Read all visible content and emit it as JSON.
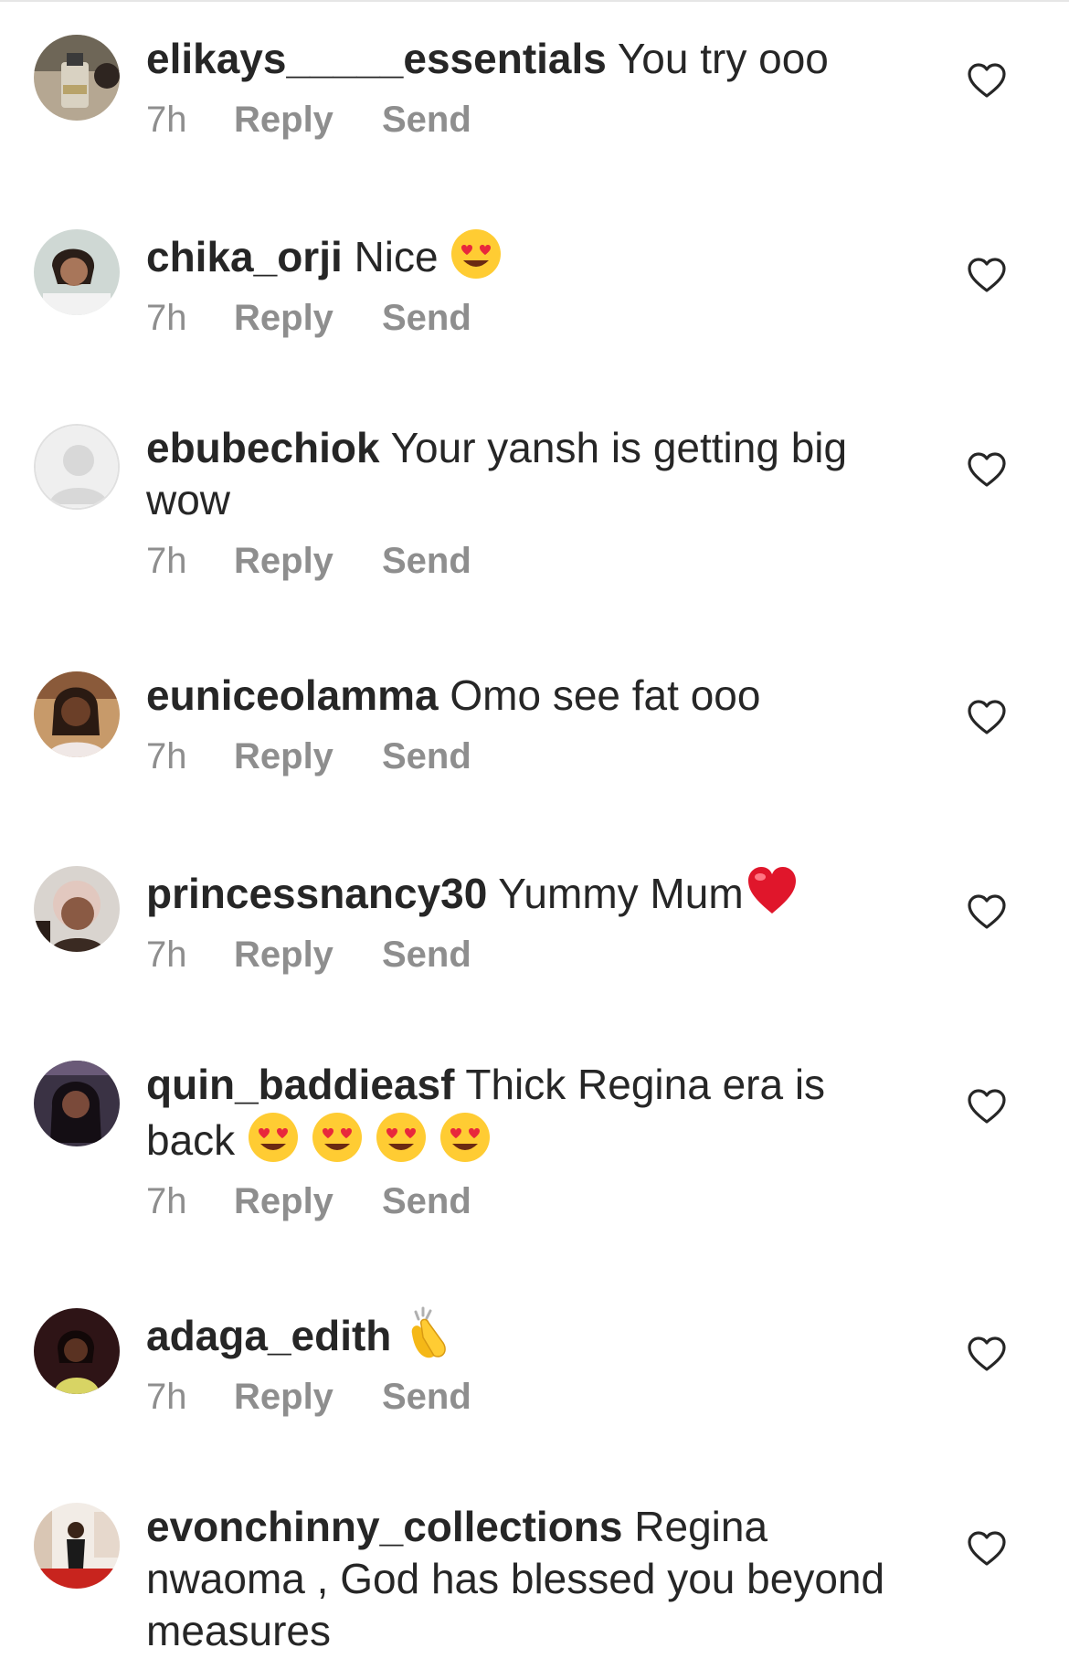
{
  "comments": [
    {
      "username": "elikays_____essentials",
      "text": "You try ooo",
      "emojis": [],
      "time": "7h",
      "reply_label": "Reply",
      "send_label": "Send",
      "avatar": "perfume-bottle-photo"
    },
    {
      "username": "chika_orji",
      "text": "Nice",
      "emojis": [
        "heart-eyes"
      ],
      "time": "7h",
      "reply_label": "Reply",
      "send_label": "Send",
      "avatar": "selfie-photo"
    },
    {
      "username": "ebubechiok",
      "text": "Your yansh is getting big wow",
      "emojis": [],
      "time": "7h",
      "reply_label": "Reply",
      "send_label": "Send",
      "avatar": "default-placeholder"
    },
    {
      "username": "euniceolamma",
      "text": "Omo see fat ooo",
      "emojis": [],
      "time": "7h",
      "reply_label": "Reply",
      "send_label": "Send",
      "avatar": "portrait-photo"
    },
    {
      "username": "princessnancy30",
      "text": "Yummy Mum",
      "emojis": [
        "red-heart"
      ],
      "time": "7h",
      "reply_label": "Reply",
      "send_label": "Send",
      "avatar": "portrait-photo"
    },
    {
      "username": "quin_baddieasf",
      "text": "Thick Regina era is back",
      "emojis": [
        "heart-eyes",
        "heart-eyes",
        "heart-eyes",
        "heart-eyes"
      ],
      "time": "7h",
      "reply_label": "Reply",
      "send_label": "Send",
      "avatar": "portrait-photo"
    },
    {
      "username": "adaga_edith",
      "text": "",
      "emojis": [
        "clapping-hands"
      ],
      "time": "7h",
      "reply_label": "Reply",
      "send_label": "Send",
      "avatar": "portrait-photo"
    },
    {
      "username": "evonchinny_collections",
      "text": "Regina nwaoma , God has blessed you beyond measures",
      "emojis": [],
      "time": "",
      "reply_label": "",
      "send_label": "",
      "avatar": "store-photo"
    }
  ],
  "colors": {
    "text": "#262626",
    "meta": "#8e8e8e",
    "heart_outline": "#262626"
  },
  "icons": {
    "like": "heart-outline-icon"
  }
}
